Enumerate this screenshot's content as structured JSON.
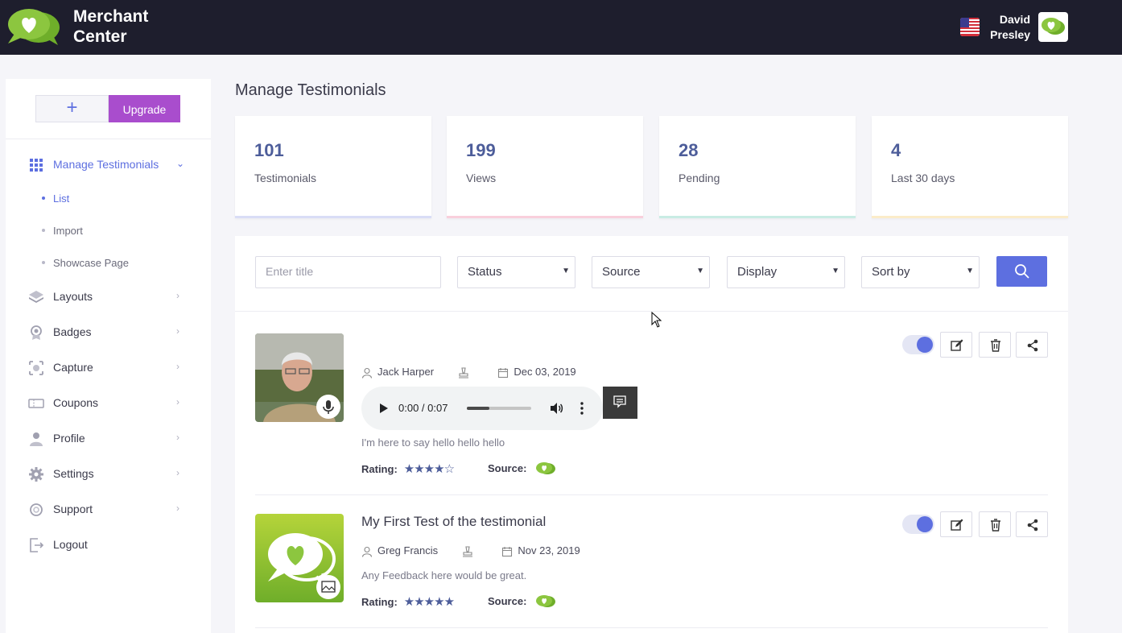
{
  "header": {
    "brand_line1": "Merchant",
    "brand_line2": "Center",
    "user_first": "David",
    "user_last": "Presley"
  },
  "sidebar": {
    "plus_label": "+",
    "upgrade_label": "Upgrade",
    "manage_label": "Manage Testimonials",
    "sub_items": [
      "List",
      "Import",
      "Showcase Page"
    ],
    "items": [
      "Layouts",
      "Badges",
      "Capture",
      "Coupons",
      "Profile",
      "Settings",
      "Support",
      "Logout"
    ]
  },
  "page": {
    "title": "Manage Testimonials"
  },
  "stats": [
    {
      "value": "101",
      "label": "Testimonials",
      "accent": "#d9ddf6"
    },
    {
      "value": "199",
      "label": "Views",
      "accent": "#f9cfdc"
    },
    {
      "value": "28",
      "label": "Pending",
      "accent": "#c9ece4"
    },
    {
      "value": "4",
      "label": "Last 30 days",
      "accent": "#fbecc9"
    }
  ],
  "filters": {
    "title_placeholder": "Enter title",
    "status": "Status",
    "source": "Source",
    "display": "Display",
    "sort": "Sort by"
  },
  "testimonials": [
    {
      "author": "Jack Harper",
      "date": "Dec 03, 2019",
      "audio_time": "0:00 / 0:07",
      "audio_progress": 0.35,
      "feedback": "I'm here to say hello hello hello",
      "rating_label": "Rating:",
      "stars": "★★★★☆",
      "source_label": "Source:"
    },
    {
      "title": "My First Test of the testimonial",
      "author": "Greg Francis",
      "date": "Nov 23, 2019",
      "feedback": "Any Feedback here would be great.",
      "rating_label": "Rating:",
      "stars": "★★★★★",
      "source_label": "Source:"
    }
  ],
  "colors": {
    "accent": "#5d6fe0",
    "upgrade": "#a94dcd",
    "topbar": "#1e1e2d",
    "brand_green": "#8cc63f"
  }
}
